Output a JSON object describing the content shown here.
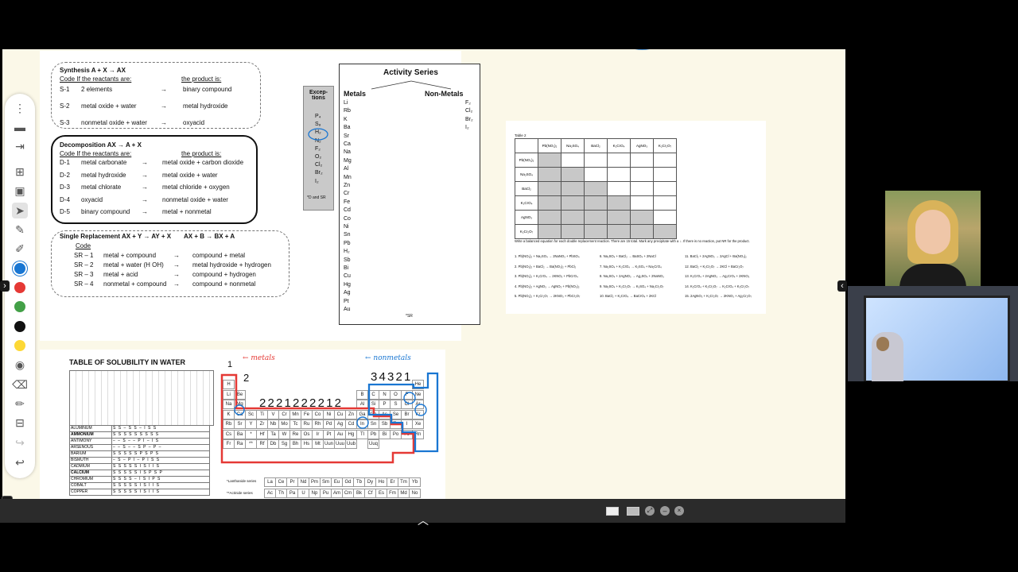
{
  "synthesis": {
    "title": "Synthesis  A + X → AX",
    "code_hdr": "Code   If the reactants are:",
    "prod_hdr": "the product is:",
    "rows": [
      {
        "code": "S-1",
        "react": "2 elements",
        "prod": "binary compound"
      },
      {
        "code": "S-2",
        "react": "metal oxide + water",
        "prod": "metal hydroxide"
      },
      {
        "code": "S-3",
        "react": "nonmetal oxide + water",
        "prod": "oxyacid"
      }
    ]
  },
  "decomposition": {
    "title": "Decomposition  AX → A + X",
    "code_hdr": "Code   If the reactants are:",
    "prod_hdr": "the product is:",
    "rows": [
      {
        "code": "D-1",
        "react": "metal carbonate",
        "prod": "metal oxide + carbon dioxide"
      },
      {
        "code": "D-2",
        "react": "metal hydroxide",
        "prod": "metal oxide + water"
      },
      {
        "code": "D-3",
        "react": "metal chlorate",
        "prod": "metal chloride + oxygen"
      },
      {
        "code": "D-4",
        "react": "oxyacid",
        "prod": "nonmetal oxide + water"
      },
      {
        "code": "D-5",
        "react": "binary compound",
        "prod": "metal + nonmetal"
      }
    ]
  },
  "single": {
    "title": "Single Replacement  AX + Y → AY + X",
    "title2": "AX + B → BX + A",
    "code_hdr": "Code",
    "rows": [
      {
        "code": "SR – 1",
        "react": "metal + compound",
        "prod": "compound + metal"
      },
      {
        "code": "SR – 2",
        "react": "metal + water (H OH)",
        "prod": "metal hydroxide + hydrogen"
      },
      {
        "code": "SR – 3",
        "react": "metal + acid",
        "prod": "compound + hydrogen"
      },
      {
        "code": "SR – 4",
        "react": "nonmetal + compound",
        "prod": "compound + nonmetal"
      }
    ]
  },
  "exceptions": {
    "title": "Excep-tions",
    "items": [
      "P₄",
      "S₈",
      "H₂",
      "N₂",
      "F₂",
      "O₂",
      "Cl₂",
      "Br₂",
      "I₂"
    ],
    "note": "*D and SR"
  },
  "activity": {
    "title": "Activity Series",
    "metals_label": "Metals",
    "nonmetals_label": "Non-Metals",
    "metals": [
      "Li",
      "Rb",
      "K",
      "Ba",
      "Sr",
      "Ca",
      "Na",
      "Mg",
      "Al",
      "Mn",
      "Zn",
      "Cr",
      "Fe",
      "Cd",
      "Co",
      "Ni",
      "Sn",
      "Pb",
      "H₂",
      "Sb",
      "Bi",
      "Cu",
      "Hg",
      "Ag",
      "Pt",
      "Au"
    ],
    "nonmetals": [
      "F₂",
      "Cl₂",
      "Br₂",
      "I₂"
    ],
    "footnote": "*SR"
  },
  "table2": {
    "title": "Table 2",
    "headers": [
      "Pb(NO₃)₂",
      "Na₂SO₄",
      "BaCl₂",
      "K₂CrO₄",
      "AgNO₃",
      "K₂Cr₂O₇"
    ],
    "rows": [
      "Pb(NO₃)₂",
      "Na₂SO₄",
      "BaCl₂",
      "K₂CrO₄",
      "AgNO₃",
      "K₂Cr₂O₇"
    ],
    "instructions": "Write a balanced equation for each double replacement reaction. There are 15 total. Mark any precipitate with a ↓. If there is no reaction, put NR for the product.",
    "equations": [
      "1. Pb(NO₃)₂ + Na₂SO₄ → 2NaNO₃ + PbSO₄",
      "2. Pb(NO₃)₂ + BaCl₂ → Ba(NO₃)₂ + PbCl₂",
      "3. Pb(NO₃)₂ + K₂CrO₄ → 2KNO₃ + PbCrO₄",
      "4. Pb(NO₃)₂ + AgNO₃ → AgNO₃ + Pb(NO₃)₂",
      "5. Pb(NO₃)₂ + K₂Cr₂O₇ → 2KNO₃ + PbCr₂O₇",
      "6. Na₂SO₄ + BaCl₂ → BaSO₄ + 2NaCl",
      "7. Na₂SO₄ + K₂CrO₄ → K₂SO₄ + Na₂CrO₄",
      "8. Na₂SO₄ + 2AgNO₃ → Ag₂SO₄ + 2NaNO₃",
      "9. Na₂SO₄ + K₂Cr₂O₇ → K₂SO₄ + Na₂Cr₂O₇",
      "10. BaCl₂ + K₂CrO₄ → BaCrO₄ + 2KCl",
      "11. BaCl₂ + 2AgNO₃ → 2AgCl + Ba(NO₃)₂",
      "12. BaCl₂ + K₂Cr₂O₇ → 2KCl + BaCr₂O₇",
      "13. K₂CrO₄ + 2AgNO₃ → Ag₂CrO₄ + 2KNO₃",
      "14. K₂CrO₄ + K₂Cr₂O₇ → K₂CrO₄ + K₂Cr₂O₇",
      "15. 2AgNO₃ + K₂Cr₂O₇ → 2KNO₃ + Ag₂Cr₂O₇"
    ]
  },
  "solubility": {
    "title": "TABLE OF SOLUBILITY IN WATER",
    "cations": [
      "ALUMINUM",
      "AMMONIUM",
      "ANTIMONY",
      "ARSENOUS",
      "BARIUM",
      "BISMUTH",
      "CADMIUM",
      "CALCIUM",
      "CHROMIUM",
      "COBALT",
      "COPPER"
    ],
    "cells": [
      "S S – S S – I S S",
      "S S S S S S S S S",
      "– – S – – P I – I S",
      "– – S – – S P – P –",
      "S S S S S P S P S",
      "– S – P I – P I S S",
      "S S S S S I S I I S",
      "S S S S S I S P S P",
      "S S S S – I S I P S",
      "S S S S S I S I I S",
      "S S S S S I S I I S"
    ]
  },
  "annotations": {
    "metals_note": "← metals",
    "nonmetals_note": "← nonmetals",
    "group1": "1",
    "group2": "2",
    "charges_metals": "2 2 2 1 2 2 2 2 1 2",
    "charges_nonmetals": "3 4 3 2 1"
  },
  "ptable": {
    "lanthanide_label": "*Lanthanide series",
    "actinide_label": "**Actinide series",
    "rows": [
      [
        "H",
        "",
        "",
        "",
        "",
        "",
        "",
        "",
        "",
        "",
        "",
        "",
        "",
        "",
        "",
        "",
        "",
        "He"
      ],
      [
        "Li",
        "Be",
        "",
        "",
        "",
        "",
        "",
        "",
        "",
        "",
        "",
        "",
        "B",
        "C",
        "N",
        "O",
        "F",
        "Ne"
      ],
      [
        "Na",
        "Mg",
        "",
        "",
        "",
        "",
        "",
        "",
        "",
        "",
        "",
        "",
        "Al",
        "Si",
        "P",
        "S",
        "Cl",
        "Ar"
      ],
      [
        "K",
        "Ca",
        "Sc",
        "Ti",
        "V",
        "Cr",
        "Mn",
        "Fe",
        "Co",
        "Ni",
        "Cu",
        "Zn",
        "Ga",
        "Ge",
        "As",
        "Se",
        "Br",
        "Kr"
      ],
      [
        "Rb",
        "Sr",
        "Y",
        "Zr",
        "Nb",
        "Mo",
        "Tc",
        "Ru",
        "Rh",
        "Pd",
        "Ag",
        "Cd",
        "In",
        "Sn",
        "Sb",
        "Te",
        "I",
        "Xe"
      ],
      [
        "Cs",
        "Ba",
        "*",
        "Hf",
        "Ta",
        "W",
        "Re",
        "Os",
        "Ir",
        "Pt",
        "Au",
        "Hg",
        "Tl",
        "Pb",
        "Bi",
        "Po",
        "At",
        "Rn"
      ],
      [
        "Fr",
        "Ra",
        "**",
        "Rf",
        "Db",
        "Sg",
        "Bh",
        "Hs",
        "Mt",
        "Uun",
        "Uuu",
        "Uub",
        "",
        "Uuq",
        "",
        "",
        "",
        ""
      ]
    ],
    "lanth": [
      "La",
      "Ce",
      "Pr",
      "Nd",
      "Pm",
      "Sm",
      "Eu",
      "Gd",
      "Tb",
      "Dy",
      "Ho",
      "Er",
      "Tm",
      "Yb"
    ],
    "actin": [
      "Ac",
      "Th",
      "Pa",
      "U",
      "Np",
      "Pu",
      "Am",
      "Cm",
      "Bk",
      "Cf",
      "Es",
      "Fm",
      "Md",
      "No"
    ]
  },
  "colors": {
    "accent": "#1976d2",
    "red": "#e53935",
    "green": "#43a047",
    "black": "#111111",
    "yellow": "#fdd835",
    "canvas": "#fbf8e8"
  }
}
